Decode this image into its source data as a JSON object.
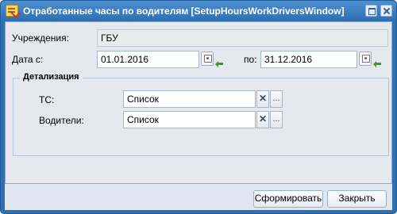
{
  "window": {
    "title": "Отработанные часы по водителям [SetupHoursWorkDriversWindow]"
  },
  "form": {
    "institution_label": "Учреждения:",
    "institution_value": "ГБУ",
    "date_from_label": "Дата с:",
    "date_from_value": "01.01.2016",
    "date_to_label": "по:",
    "date_to_value": "31.12.2016"
  },
  "details": {
    "legend": "Детализация",
    "vehicles_label": "ТС:",
    "vehicles_value": "Список",
    "drivers_label": "Водители:",
    "drivers_value": "Список",
    "clear_glyph": "✕",
    "select_glyph": "..."
  },
  "footer": {
    "generate_label": "Сформировать",
    "close_label": "Закрыть"
  },
  "colors": {
    "titlebar": "#2f6fb0",
    "panel": "#e5e9ef"
  }
}
